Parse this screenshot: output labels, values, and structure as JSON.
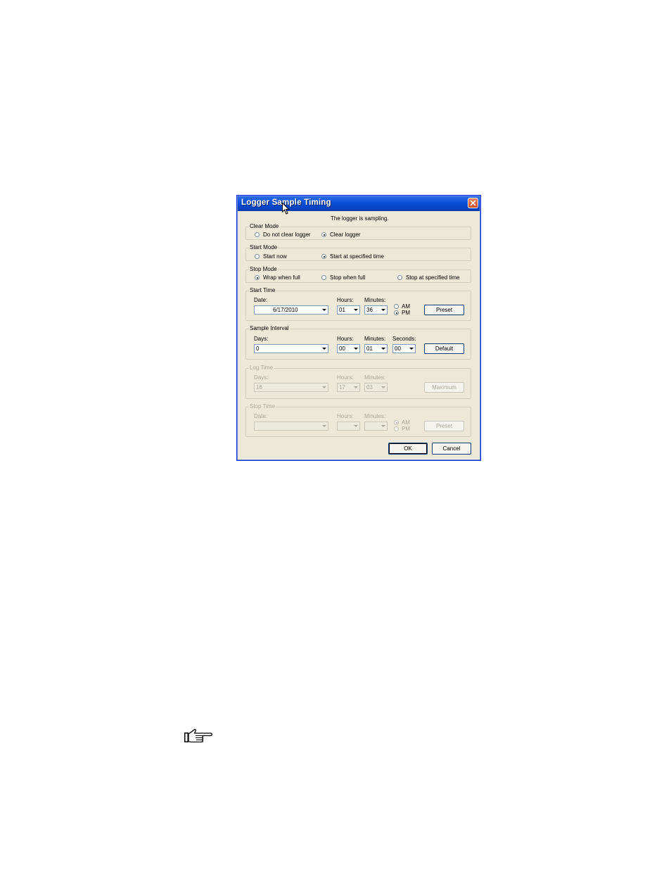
{
  "dialog": {
    "title": "Logger Sample Timing",
    "status_text": "The logger is sampling."
  },
  "clear_mode": {
    "legend": "Clear Mode",
    "options": [
      {
        "label": "Do not clear logger",
        "checked": false
      },
      {
        "label": "Clear logger",
        "checked": true
      }
    ]
  },
  "start_mode": {
    "legend": "Start Mode",
    "options": [
      {
        "label": "Start now",
        "checked": false
      },
      {
        "label": "Start at specified time",
        "checked": true
      }
    ]
  },
  "stop_mode": {
    "legend": "Stop Mode",
    "options": [
      {
        "label": "Wrap when full",
        "checked": true
      },
      {
        "label": "Stop when full",
        "checked": false
      },
      {
        "label": "Stop at specified time",
        "checked": false
      }
    ]
  },
  "start_time": {
    "legend": "Start Time",
    "date_label": "Date:",
    "date_value": "6/17/2010",
    "hours_label": "Hours:",
    "hours_value": "01",
    "minutes_label": "Minutes:",
    "minutes_value": "36",
    "am_label": "AM",
    "pm_label": "PM",
    "pm_checked": true,
    "preset_label": "Preset"
  },
  "sample_interval": {
    "legend": "Sample Interval",
    "days_label": "Days:",
    "days_value": "0",
    "hours_label": "Hours:",
    "hours_value": "00",
    "minutes_label": "Minutes:",
    "minutes_value": "01",
    "seconds_label": "Seconds:",
    "seconds_value": "00",
    "default_label": "Default"
  },
  "log_time": {
    "legend": "Log Time",
    "days_label": "Days:",
    "days_value": "16",
    "hours_label": "Hours:",
    "hours_value": "17",
    "minutes_label": "Minutes:",
    "minutes_value": "03",
    "maximum_label": "Maximum"
  },
  "stop_time": {
    "legend": "Stop Time",
    "date_label": "Date:",
    "date_value": "",
    "hours_label": "Hours:",
    "hours_value": "",
    "minutes_label": "Minutes:",
    "minutes_value": "",
    "am_label": "AM",
    "pm_label": "PM",
    "am_checked": true,
    "preset_label": "Preset"
  },
  "footer": {
    "ok_label": "OK",
    "cancel_label": "Cancel"
  },
  "icons": {
    "close": "close-icon",
    "cursor": "mouse-cursor-icon",
    "note": "pointing-hand-icon"
  },
  "colors": {
    "titlebar": "#0a4fd8",
    "dialog_bg": "#ece9d8",
    "close_button": "#d24a22",
    "disabled_text": "#aca899"
  }
}
